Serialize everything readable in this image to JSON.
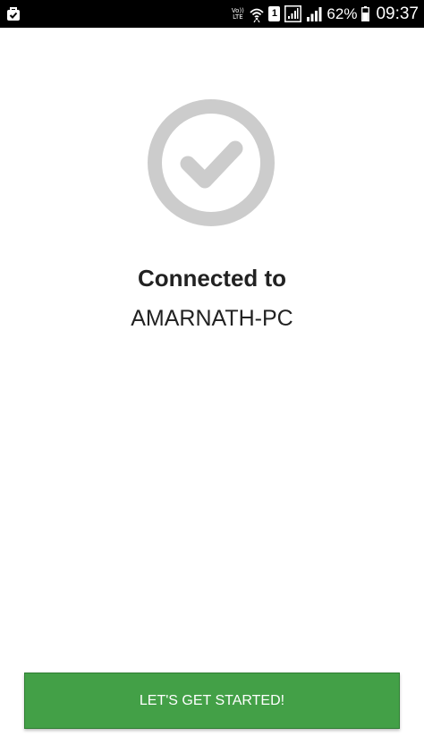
{
  "status_bar": {
    "volte_line1": "Vo))",
    "volte_line2": "LTE",
    "sim_label": "1",
    "battery": "62%",
    "time": "09:37",
    "icons": [
      "notification-bag-icon",
      "wifi-icon",
      "sim-card-icon",
      "sim-signal-icon",
      "signal-icon",
      "battery-icon"
    ]
  },
  "status": {
    "icon": "check-circle-icon",
    "title": "Connected to",
    "device": "AMARNATH-PC"
  },
  "action": {
    "label": "LET'S GET STARTED!"
  },
  "colors": {
    "primary_button": "#43a047",
    "check_gray": "#cccccc",
    "text": "#222222"
  }
}
